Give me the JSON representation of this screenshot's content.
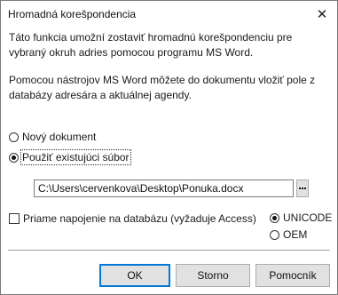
{
  "dialog": {
    "title": "Hromadná korešpondencia",
    "close_glyph": "✕"
  },
  "intro": {
    "paragraph1": "Táto funkcia umožní zostaviť hromadnú korešpondenciu pre\nvybraný okruh adries pomocou programu MS Word.",
    "paragraph2": "Pomocou nástrojov MS Word môžete do dokumentu vložiť pole z\ndatabázy adresára a aktuálnej agendy."
  },
  "document_options": {
    "new_document": {
      "label": "Nový dokument",
      "checked": false
    },
    "existing_file": {
      "label": "Použiť existujúci súbor",
      "checked": true
    }
  },
  "file_path": {
    "value": "C:\\Users\\cervenkova\\Desktop\\Ponuka.docx",
    "browse_icon": "ellipsis-icon"
  },
  "direct_connection": {
    "label": "Priame napojenie na databázu (vyžaduje Access)",
    "checked": false
  },
  "encoding": {
    "unicode": {
      "label": "UNICODE",
      "checked": true
    },
    "oem": {
      "label": "OEM",
      "checked": false
    }
  },
  "buttons": {
    "ok": "OK",
    "cancel": "Storno",
    "help": "Pomocník"
  },
  "colors": {
    "default_button_border": "#0078d7",
    "button_face": "#e1e1e1"
  }
}
